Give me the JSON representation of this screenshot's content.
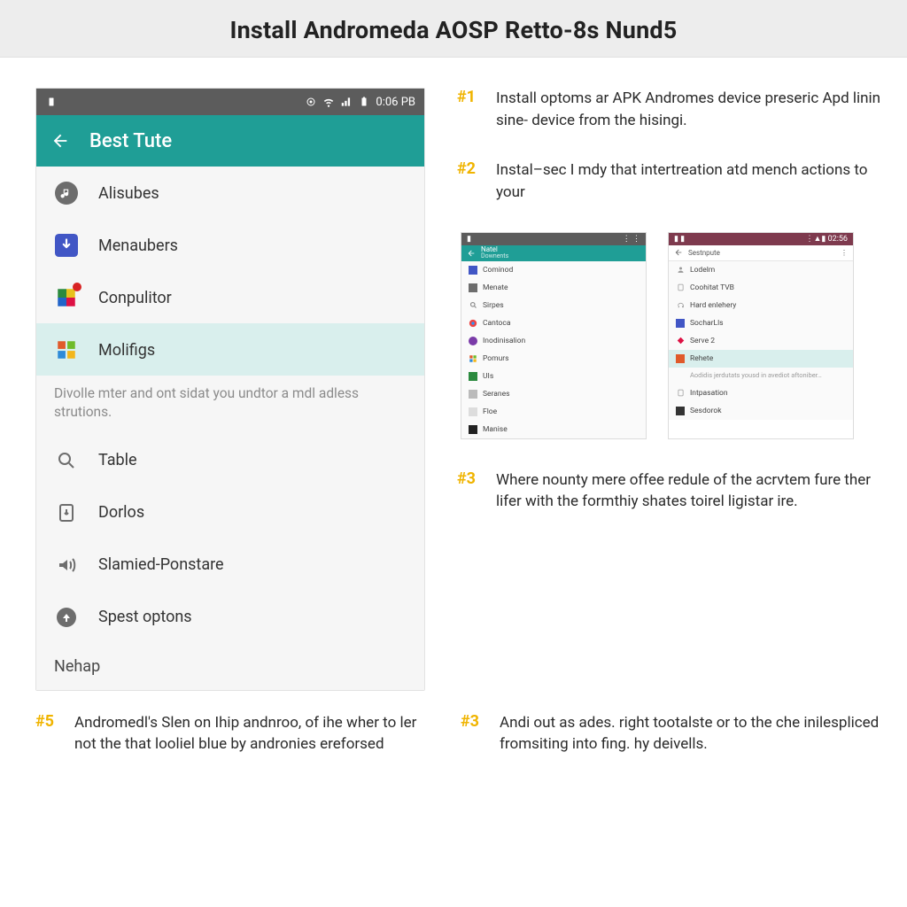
{
  "header": {
    "title": "Install Andromeda AOSP Retto-8s Nund5"
  },
  "phone": {
    "status": {
      "time": "0:06 PB"
    },
    "appbar_title": "Best Tute",
    "items": [
      {
        "label": "Alisubes",
        "icon": "music-icon",
        "sel": false
      },
      {
        "label": "Menaubers",
        "icon": "download-icon",
        "sel": false
      },
      {
        "label": "Conpulitor",
        "icon": "photos-icon",
        "sel": false,
        "badge": true
      },
      {
        "label": "Molifigs",
        "icon": "windows-icon",
        "sel": true
      },
      {
        "label": "Table",
        "icon": "search-icon",
        "sel": false
      },
      {
        "label": "Dorlos",
        "icon": "doc-down-icon",
        "sel": false
      },
      {
        "label": "Slamied-Ponstare",
        "icon": "sound-icon",
        "sel": false
      },
      {
        "label": "Spest optons",
        "icon": "share-icon",
        "sel": false
      }
    ],
    "note": "Divolle mter and ont sidat you undtor a mdl adless strutions.",
    "footer": "Nehap"
  },
  "steps": {
    "s1": {
      "mark": "#1",
      "text": "Install optoms ar APK Andromes device preseric Apd linin sine- device from the hisingi."
    },
    "s2": {
      "mark": "#2",
      "text": "Instal–sec I mdy that intertreation atd mench actions to your"
    },
    "s3": {
      "mark": "#3",
      "text": "Where nounty mere offee redule of the acrvtem fure ther lifer with the formthiy shates toirel ligistar ire."
    },
    "s5": {
      "mark": "#5",
      "text": "Andromedl's Slen on Ihip andnroo, of ihe wher to ler not the that looliel blue by andronies ereforsed"
    },
    "s3b": {
      "mark": "#3",
      "text": "Andi out as ades. right tootalste or to the che inilespliced fromsiting into fing. hy deivells."
    }
  },
  "mini": {
    "a": {
      "title": "Natel",
      "sub": "Downents",
      "items": [
        "Cominod",
        "Menate",
        "Sirpes",
        "Cantoca",
        "Inodinisalion",
        "Pomurs",
        "UIs",
        "Seranes",
        "Floe",
        "Manise"
      ]
    },
    "b": {
      "time": "02:56",
      "title": "Sestnpute",
      "items": [
        "Lodelm",
        "Coohitat TVB",
        "Hard enlehery",
        "SocharLls",
        "Serve 2",
        "Rehete"
      ],
      "note": "Aodidis jerdutats yousd in avediot aftoniber…",
      "tail": [
        "Intpasation",
        "Sesdorok"
      ]
    }
  }
}
